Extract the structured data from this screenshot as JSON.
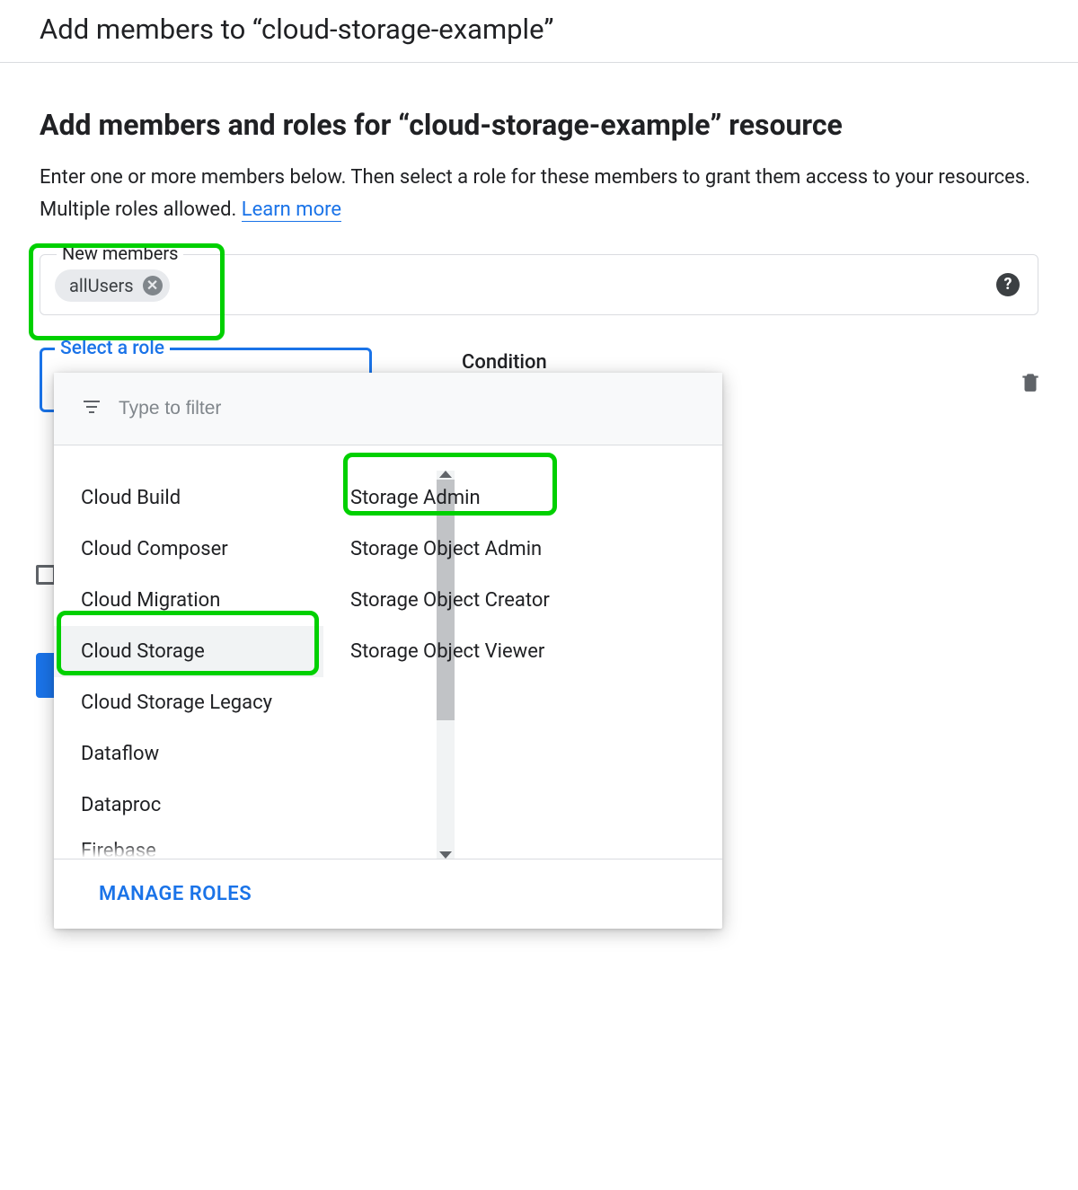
{
  "header": {
    "title": "Add members to “cloud-storage-example”"
  },
  "section": {
    "title": "Add members and roles for “cloud-storage-example” resource",
    "description_prefix": "Enter one or more members below. Then select a role for these members to grant them access to your resources. Multiple roles allowed. ",
    "learn_more": "Learn more"
  },
  "members_field": {
    "legend": "New members",
    "chip": "allUsers"
  },
  "role_field": {
    "legend": "Select a role",
    "condition_label": "Condition"
  },
  "role_dropdown": {
    "filter_placeholder": "Type to filter",
    "categories": [
      "Cloud Build",
      "Cloud Composer",
      "Cloud Migration",
      "Cloud Storage",
      "Cloud Storage Legacy",
      "Dataflow",
      "Dataproc",
      "Firebase"
    ],
    "selected_category_index": 3,
    "roles": [
      "Storage Admin",
      "Storage Object Admin",
      "Storage Object Creator",
      "Storage Object Viewer"
    ],
    "footer_action": "MANAGE ROLES"
  }
}
